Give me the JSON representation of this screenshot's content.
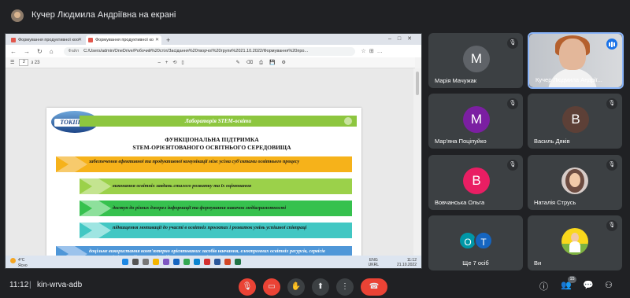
{
  "presenter_banner": {
    "label": "Кучер Людмила Андріївна на екрані"
  },
  "browser": {
    "tabs": [
      {
        "title": "Формування продуктивної коо"
      },
      {
        "title": "Формування продуктивної ко"
      }
    ],
    "url_prefix": "Файл",
    "url": "C:/Users/admin/OneDrive/Робочий%20стіл/Засідання%20творчої%20групи%2021.10.2022/Формування%20про...",
    "page_current": "2",
    "page_total": "з 23"
  },
  "slide": {
    "header": "Лабораторія STEM-освіти",
    "logo_text": "ТОКІППО",
    "title_line1": "ФУНКЦІОНАЛЬНА ПІДТРИМКА",
    "title_line2": "STEM-ОРІЄНТОВАНОГО ОСВІТНЬОГО СЕРЕДОВИЩА",
    "items": [
      "забезпечення ефективної та продуктивної комунікації між усіма суб'єктами освітнього процесу",
      "виконання освітніх завдань сталого розвитку та їх оцінювання",
      "доступ до різних джерел інформації та формування навичок медіаграмотності",
      "підвищення мотивації до участі в освітніх проєктах і розвиток умінь успішної співпраці",
      "доцільне використання комп'ютерно орієнтованих засобів навчання, електронних освітніх ресурсів, сервісів локальних інформаційно-комунікаційних мереж закладу освіти"
    ]
  },
  "taskbar": {
    "temp": "4°C",
    "weather": "Ясно",
    "lang1": "ENG",
    "lang2": "UKRL",
    "time": "11:12",
    "date": "21.10.2022"
  },
  "participants": [
    {
      "name": "Марія Мачужак",
      "initial": "М",
      "color": "#5f6368"
    },
    {
      "name": "Кучер Людмила Андрії...",
      "initial": "",
      "color": ""
    },
    {
      "name": "Мар'яна Поціпуйко",
      "initial": "М",
      "color": "#7b1fa2"
    },
    {
      "name": "Василь Дяків",
      "initial": "В",
      "color": "#5d4037"
    },
    {
      "name": "Вовчанська Ольга",
      "initial": "В",
      "color": "#e91e63"
    },
    {
      "name": "Наталія Струсь",
      "initial": "",
      "color": ""
    },
    {
      "name": "Ще 7 осіб",
      "initial": "",
      "color": ""
    },
    {
      "name": "Ви",
      "initial": "",
      "color": ""
    }
  ],
  "others_stack": [
    {
      "initial": "О",
      "color": "#0097a7"
    },
    {
      "initial": "Т",
      "color": "#1565c0"
    }
  ],
  "bottom_bar": {
    "time": "11:12",
    "separator": "|",
    "meeting_code": "kin-wrva-adb",
    "participant_count": "15"
  }
}
